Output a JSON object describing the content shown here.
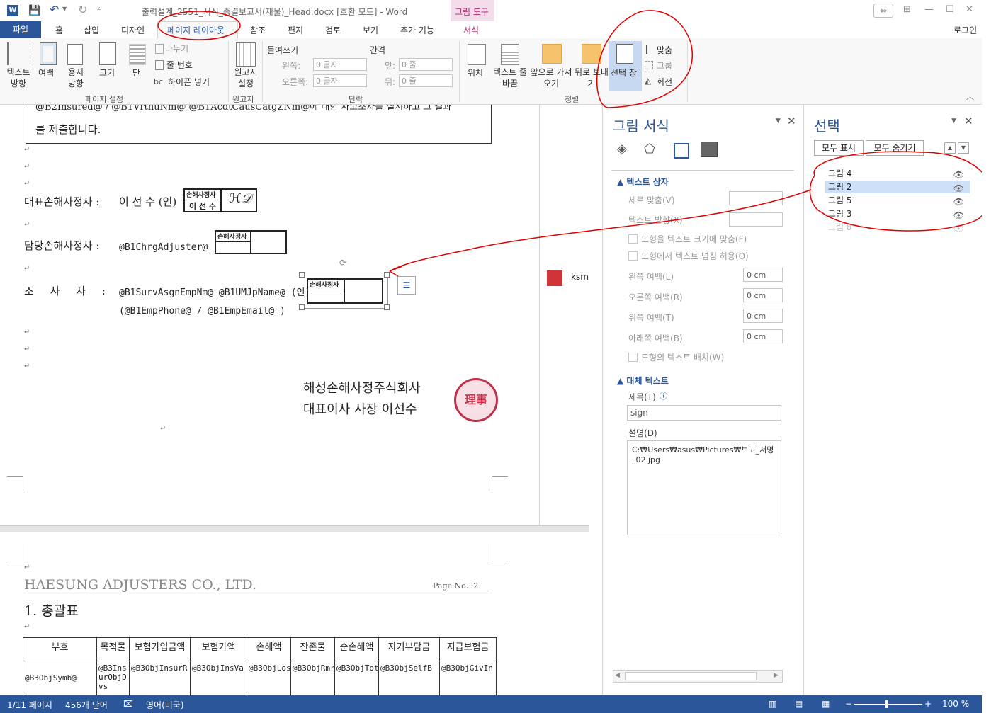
{
  "title_bar": {
    "doc_title": "출력설계_2551_서식_종결보고서(재물)_Head.docx [호환 모드] - Word",
    "context_tools": "그림 도구",
    "help": "?",
    "login": "로그인"
  },
  "tabs": [
    "파일",
    "홈",
    "삽입",
    "디자인",
    "페이지 레이아웃",
    "참조",
    "편지",
    "검토",
    "보기",
    "추가 기능",
    "서식"
  ],
  "ribbon": {
    "page_setup": {
      "text_direction": "텍스트 방향",
      "margins": "여백",
      "orientation": "용지 방향",
      "size": "크기",
      "columns": "단",
      "breaks": "나누기",
      "line_numbers": "줄 번호",
      "hyphenation": "하이픈 넣기",
      "group": "페이지 설정"
    },
    "manuscript": {
      "label": "원고지 설정",
      "group": "원고지"
    },
    "paragraph": {
      "indent": "들여쓰기",
      "spacing": "간격",
      "left": "왼쪽:",
      "right": "오른쪽:",
      "before": "앞:",
      "after": "뒤:",
      "left_val": "0 글자",
      "right_val": "0 글자",
      "before_val": "0 줄",
      "after_val": "0 줄",
      "group": "단락"
    },
    "arrange": {
      "position": "위치",
      "wrap": "텍스트 줄 바꿈",
      "bring_forward": "앞으로 가져오기",
      "send_backward": "뒤로 보내기",
      "selection_pane": "선택 창",
      "align": "맞춤",
      "group_cmd": "그룹",
      "rotate": "회전",
      "group": "정렬"
    }
  },
  "document": {
    "top_cut": "@B2Insured@ / @B1VrthuNm@ @B1AcdtCausCatgZNm@에 대한 사고조사를 실시하고 그 결과",
    "box_line2": "를 제출합니다.",
    "rep_label": "대표손해사정사 :",
    "rep_name": "이 선 수 (인)",
    "stamp_title": "손해사정사",
    "stamp_name": "이 선 수",
    "stamp_sign": "ℋ𝒟",
    "chg_label": "담당손해사정사 :",
    "chg_value": "@B1ChrgAdjuster@ (인)",
    "inv_label": "조 사 자 :",
    "inv_value": "@B1SurvAsgnEmpNm@ @B1UMJpName@ (인)",
    "inv_contact": "(@B1EmpPhone@ / @B1EmpEmail@ )",
    "company": "해성손해사정주식회사",
    "ceo": "대표이사 사장 이선수",
    "seal_text": "理事",
    "comment_user": "ksm",
    "header_company": "HAESUNG ADJUSTERS CO., LTD.",
    "page_no": "Page No. :2",
    "section_title": "1. 총괄표",
    "table_headers": [
      "부호",
      "목적물",
      "보험가입금액",
      "보험가액",
      "손해액",
      "잔존물",
      "순손해액",
      "자기부담금",
      "지급보험금"
    ],
    "table_row": [
      "@B3ObjSymb@",
      "@B3InsurObjDvs",
      "@B3ObjInsurR",
      "@B3ObjInsVa",
      "@B3ObjLos",
      "@B3ObjRmr",
      "@B3ObjTot",
      "@B3ObjSelfB",
      "@B3ObjGivIn"
    ]
  },
  "format_pane": {
    "title": "그림 서식",
    "textbox_section": "텍스트 상자",
    "vertical_align": "세로 맞춤(V)",
    "text_direction": "텍스트 방향(X)",
    "resize_shape": "도형을 텍스트 크기에 맞춤(F)",
    "allow_overflow": "도형에서 텍스트 넘침 허용(O)",
    "left_margin": "왼쪽 여백(L)",
    "right_margin": "오른쪽 여백(R)",
    "top_margin": "위쪽 여백(T)",
    "bottom_margin": "아래쪽 여백(B)",
    "margin_value": "0 cm",
    "wrap_text": "도형의 텍스트 배치(W)",
    "alt_section": "대체 텍스트",
    "alt_title_label": "제목(T)",
    "alt_title_value": "sign",
    "alt_desc_label": "설명(D)",
    "alt_desc_value": "C:₩Users₩asus₩Pictures₩보고_서명_02.jpg"
  },
  "selection_pane": {
    "title": "선택",
    "show_all": "모두 표시",
    "hide_all": "모두 숨기기",
    "items": [
      "그림 4",
      "그림 2",
      "그림 5",
      "그림 3",
      "그림 8"
    ],
    "selected_index": 1
  },
  "status_bar": {
    "page": "1/11 페이지",
    "words": "456개 단어",
    "language": "영어(미국)",
    "zoom": "100 %"
  },
  "colors": {
    "word_blue": "#2b579a",
    "context_pink": "#f3ddea",
    "selected": "#cde0f7",
    "annotation_red": "#e00000"
  }
}
